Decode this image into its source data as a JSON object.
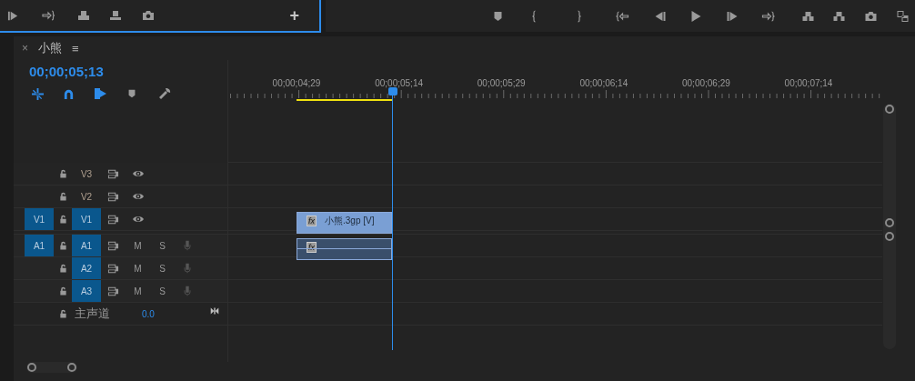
{
  "top_left_toolbar": {
    "add_button": "+"
  },
  "panel": {
    "close": "×",
    "title": "小熊",
    "menu": "≡"
  },
  "timecode": "00;00;05;13",
  "ruler": {
    "labels": [
      "00;00;04;29",
      "00;00;05;14",
      "00;00;05;29",
      "00;00;06;14",
      "00;00;06;29",
      "00;00;07;14"
    ]
  },
  "tracks": [
    {
      "kind": "video",
      "label": "V3",
      "targeted": false
    },
    {
      "kind": "video",
      "label": "V2",
      "targeted": false
    },
    {
      "kind": "video",
      "label": "V1",
      "targeted": true,
      "source_patch": "V1"
    },
    {
      "kind": "audio",
      "label": "A1",
      "targeted": true,
      "source_patch": "A1",
      "mute": "M",
      "solo": "S"
    },
    {
      "kind": "audio",
      "label": "A2",
      "targeted": true,
      "mute": "M",
      "solo": "S"
    },
    {
      "kind": "audio",
      "label": "A3",
      "targeted": true,
      "mute": "M",
      "solo": "S"
    }
  ],
  "master": {
    "label": "主声道",
    "value": "0.0"
  },
  "clips": [
    {
      "kind": "video",
      "badge": "fx",
      "name": "小熊.3gp [V]"
    },
    {
      "kind": "audio",
      "badge": "fx"
    }
  ]
}
